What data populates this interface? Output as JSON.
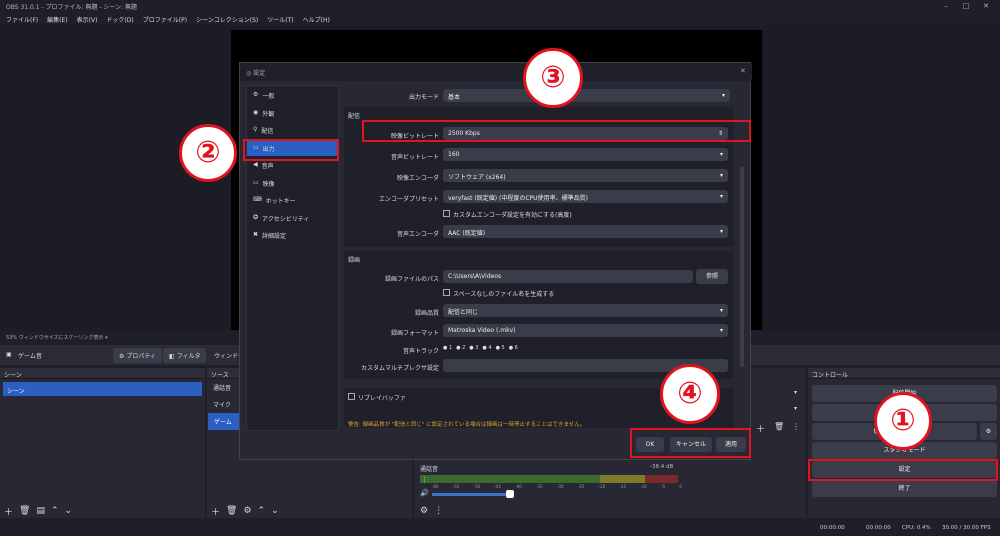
{
  "window": {
    "title": "OBS 31.0.1 - プロファイル: 無題 - シーン: 無題",
    "min": "–",
    "max": "□",
    "close": "✕"
  },
  "menu": [
    "ファイル(F)",
    "編集(E)",
    "表示(V)",
    "ドック(D)",
    "プロファイル(P)",
    "シーンコレクション(S)",
    "ツール(T)",
    "ヘルプ(H)"
  ],
  "scalebar": {
    "text": "53%  ウィンドウサイズにスケーリング表示  ▾"
  },
  "source_toolbar": {
    "label": "ゲーム音",
    "properties": "プロパティ",
    "filters": "フィルタ",
    "window": "ウィンドウ"
  },
  "docks": {
    "scenes": {
      "title": "シーン",
      "items": [
        "シーン"
      ]
    },
    "sources": {
      "title": "ソース",
      "items": [
        "通話音",
        "マイク",
        "ゲーム"
      ]
    },
    "mixer": {
      "track": "通話音",
      "db": "-38.4 dB",
      "scale": [
        "-60",
        "-55",
        "-50",
        "-45",
        "-40",
        "-35",
        "-30",
        "-25",
        "-20",
        "-15",
        "-10",
        "-5",
        "0"
      ]
    },
    "controls": {
      "title": "コントロール",
      "buttons": [
        "配信開始",
        "録画開始",
        "仮想カメラ開始",
        "スタジオモード",
        "設定",
        "終了"
      ]
    }
  },
  "status": {
    "rec": "00:00:00",
    "stream": "00:00:00",
    "cpu": "CPU: 0.4%",
    "fps": "30.00 / 30.00 FPS"
  },
  "dialog": {
    "title": "設定",
    "nav": [
      {
        "label": "一般",
        "icon": "gear-icon"
      },
      {
        "label": "外観",
        "icon": "palette-icon"
      },
      {
        "label": "配信",
        "icon": "antenna-icon"
      },
      {
        "label": "出力",
        "icon": "output-icon"
      },
      {
        "label": "音声",
        "icon": "speaker-icon"
      },
      {
        "label": "映像",
        "icon": "monitor-icon"
      },
      {
        "label": "ホットキー",
        "icon": "keyboard-icon"
      },
      {
        "label": "アクセシビリティ",
        "icon": "accessibility-icon"
      },
      {
        "label": "詳細設定",
        "icon": "wrench-icon"
      }
    ],
    "output_mode": {
      "label": "出力モード",
      "value": "基本"
    },
    "stream_section": {
      "title": "配信",
      "video_bitrate": {
        "label": "映像ビットレート",
        "value": "2500 Kbps"
      },
      "audio_bitrate": {
        "label": "音声ビットレート",
        "value": "160"
      },
      "video_encoder": {
        "label": "映像エンコーダ",
        "value": "ソフトウェア (x264)"
      },
      "encoder_preset": {
        "label": "エンコーダプリセット",
        "value": "veryfast (既定値) (中程度のCPU使用率、標準品質)"
      },
      "custom_encoder": {
        "label": "カスタムエンコーダ設定を有効にする(高度)"
      },
      "audio_encoder": {
        "label": "音声エンコーダ",
        "value": "AAC (既定値)"
      }
    },
    "rec_section": {
      "title": "録画",
      "path": {
        "label": "録画ファイルのパス",
        "value": "C:\\Users\\A\\Videos",
        "browse": "参照"
      },
      "nospace": {
        "label": "スペースなしのファイル名を生成する"
      },
      "quality": {
        "label": "録画品質",
        "value": "配信と同じ"
      },
      "format": {
        "label": "録画フォーマット",
        "value": "Matroska Video (.mkv)"
      },
      "tracks": {
        "label": "音声トラック",
        "values": [
          "1",
          "2",
          "3",
          "4",
          "5",
          "6"
        ]
      },
      "muxer": {
        "label": "カスタムマルチプレクサ設定"
      }
    },
    "replay": {
      "label": "リプレイバッファ"
    },
    "warning": "警告: 録画品質が \"配信と同じ\" に設定されている場合は録画は一時停止することはできません。",
    "buttons": {
      "ok": "OK",
      "cancel": "キャンセル",
      "apply": "適用"
    }
  },
  "annotations": [
    "①",
    "②",
    "③",
    "④"
  ],
  "colors": {
    "accent": "#2c5fc4",
    "annotation": "#e3121f",
    "bg": "#1e1f29"
  }
}
